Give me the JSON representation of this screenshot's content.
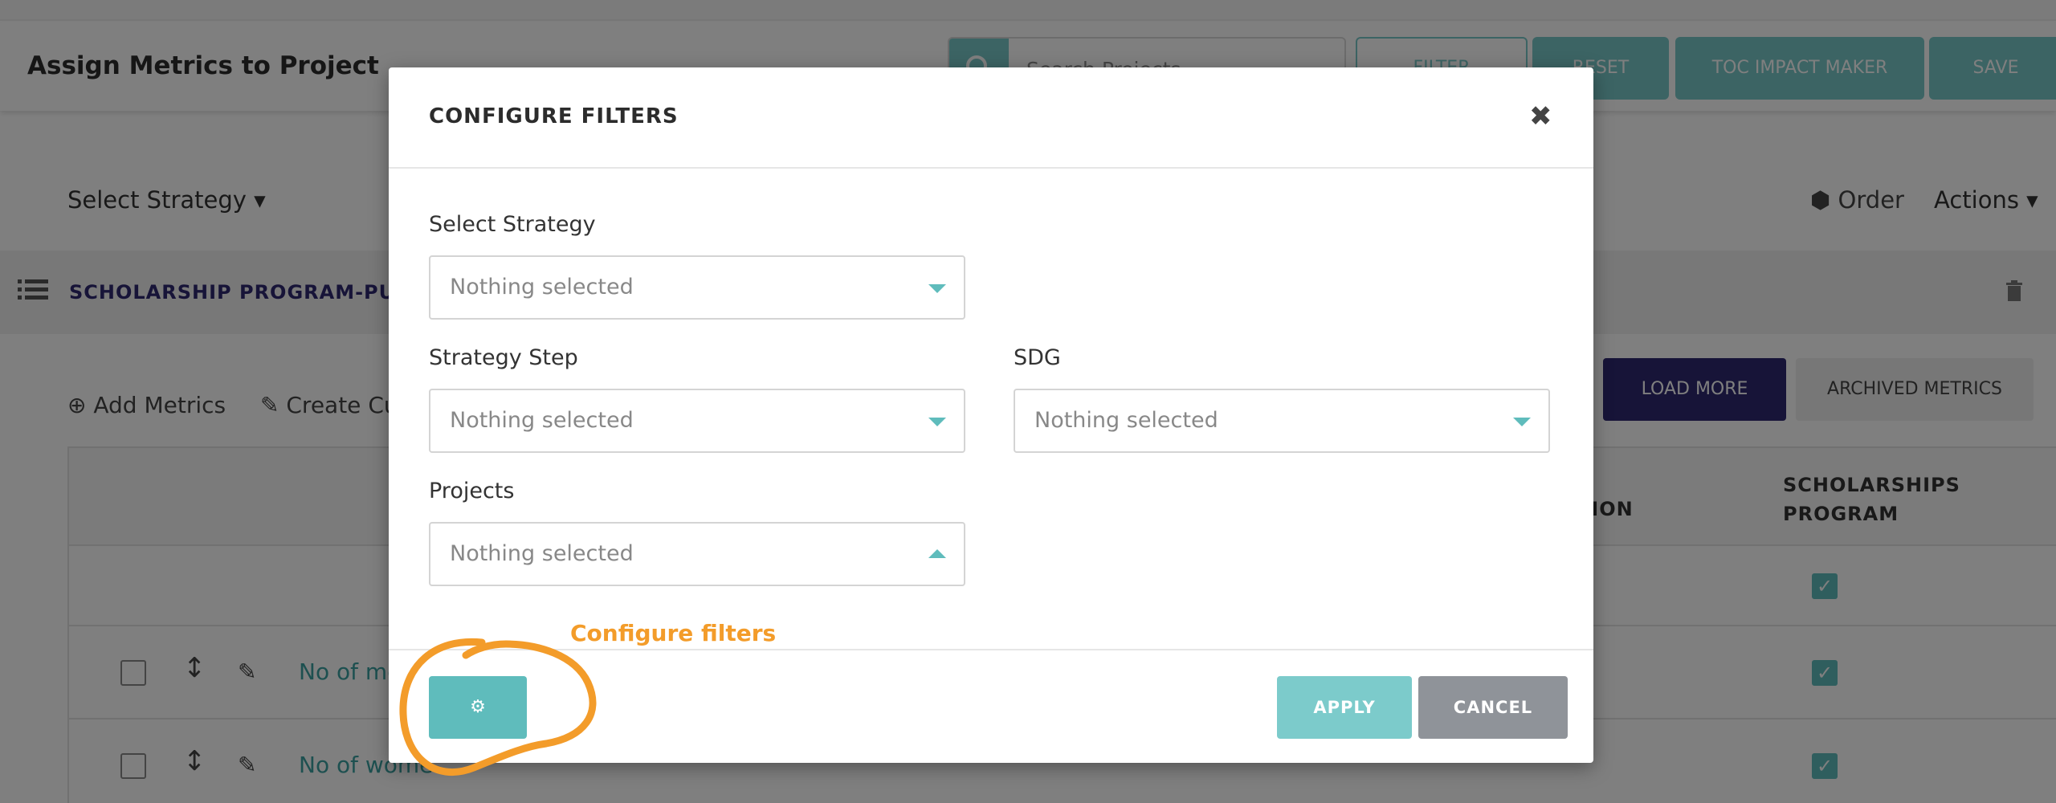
{
  "header": {
    "title": "Assign Metrics to Project",
    "search_placeholder": "Search Projects",
    "filter_label": "FILTER",
    "reset_label": "RESET",
    "toc_label": "TOC IMPACT MAKER",
    "save_label": "SAVE"
  },
  "toolbar": {
    "strategy_select": "Select Strategy",
    "order_label": "Order",
    "actions_label": "Actions"
  },
  "program": {
    "title": "SCHOLARSHIP PROGRAM-PUBL"
  },
  "metrics_bar": {
    "add_metrics": "Add Metrics",
    "create_custom": "Create Cu",
    "load_more": "LOAD MORE",
    "archived": "ARCHIVED METRICS"
  },
  "table": {
    "col_integration": "GRATION",
    "col_scholarships": "SCHOLARSHIPS PROGRAM",
    "rows": [
      {
        "label": "No of me"
      },
      {
        "label": "No of wome"
      }
    ]
  },
  "modal": {
    "title": "CONFIGURE FILTERS",
    "close_glyph": "✖",
    "fields": {
      "strategy": {
        "label": "Select Strategy",
        "value": "Nothing selected"
      },
      "strategy_step": {
        "label": "Strategy Step",
        "value": "Nothing selected"
      },
      "sdg": {
        "label": "SDG",
        "value": "Nothing selected"
      },
      "projects": {
        "label": "Projects",
        "value": "Nothing selected"
      }
    },
    "gear_glyph": "⚙",
    "apply_label": "APPLY",
    "cancel_label": "CANCEL"
  },
  "annotation": {
    "text": "Configure filters",
    "color": "#f39c2a"
  },
  "colors": {
    "accent": "#5fbcbc",
    "brand_dark": "#2e2870",
    "cancel_gray": "#8f9399"
  },
  "icons": [
    "search-icon",
    "filter-icon",
    "caret-down-icon",
    "list-icon",
    "trash-icon",
    "plus-circle-icon",
    "pencil-icon",
    "drag-icon",
    "check-icon",
    "close-icon",
    "gear-icon",
    "caret-up-icon"
  ]
}
